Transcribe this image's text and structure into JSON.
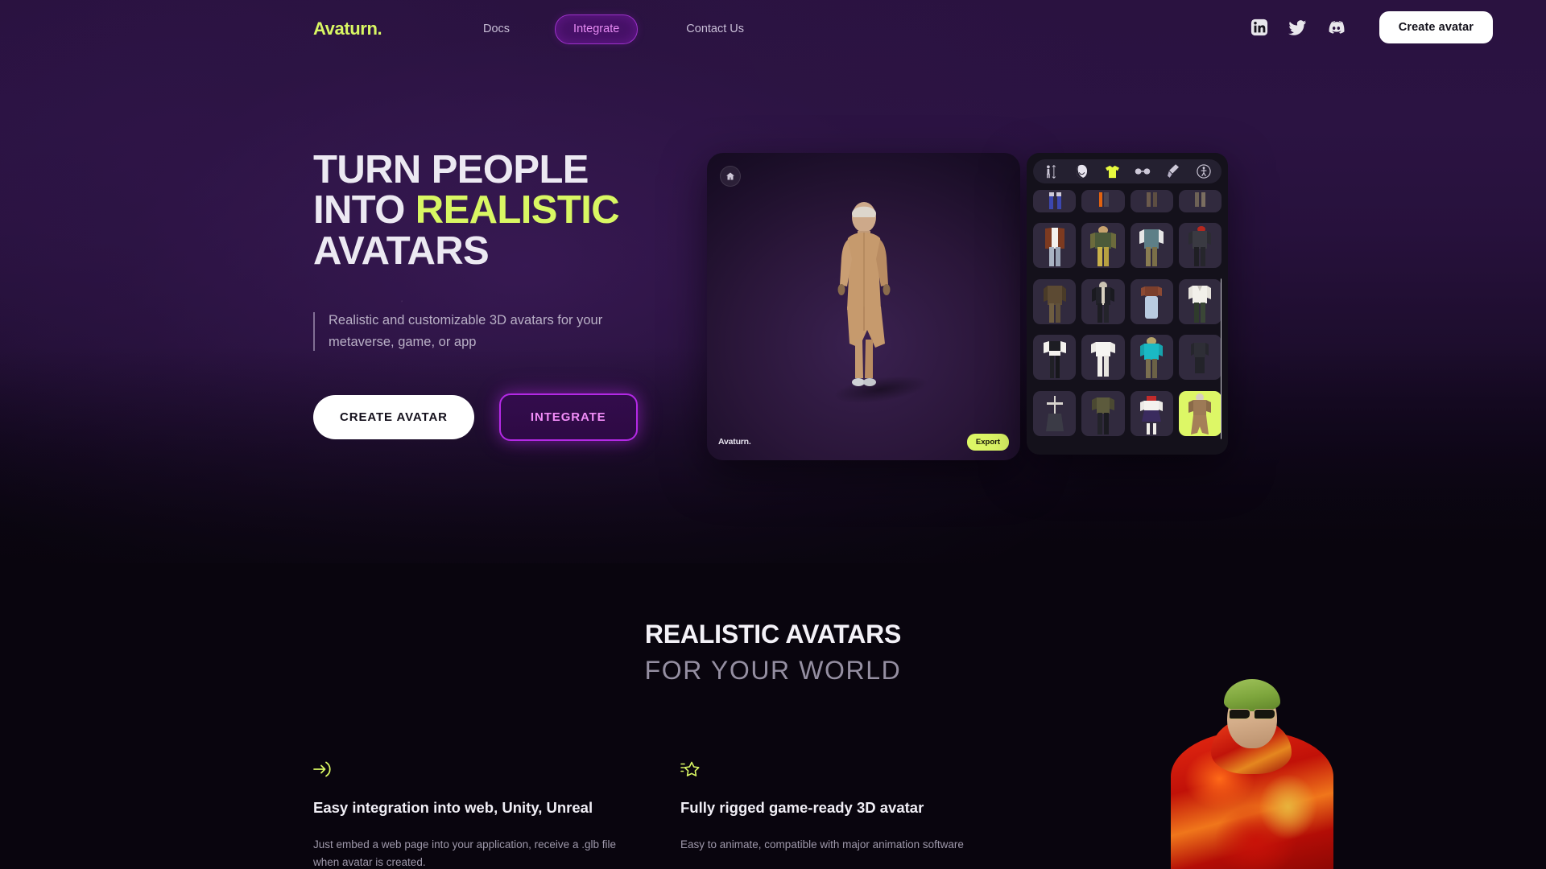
{
  "brand": {
    "name": "Avaturn.",
    "accent_color": "#d9f763",
    "purple": "#b429e6"
  },
  "header": {
    "logo": "Avaturn.",
    "nav": [
      {
        "label": "Docs",
        "active": false
      },
      {
        "label": "Integrate",
        "active": true
      },
      {
        "label": "Contact Us",
        "active": false
      }
    ],
    "socials": [
      {
        "name": "linkedin-icon"
      },
      {
        "name": "twitter-icon"
      },
      {
        "name": "discord-icon"
      }
    ],
    "cta": "Create avatar"
  },
  "hero": {
    "headline_line1": "TURN PEOPLE",
    "headline_line2_pre": "INTO ",
    "headline_line2_accent": "REALISTIC",
    "headline_line3": "AVATARS",
    "subtitle": "Realistic and customizable 3D avatars for your metaverse, game, or app",
    "primary_cta": "CREATE AVATAR",
    "secondary_cta": "INTEGRATE"
  },
  "editor": {
    "home_icon": "home-icon",
    "watermark": "Avaturn.",
    "export_label": "Export",
    "tabs": [
      {
        "name": "body-height-icon",
        "selected": false
      },
      {
        "name": "face-head-icon",
        "selected": false
      },
      {
        "name": "clothing-tshirt-icon",
        "selected": true
      },
      {
        "name": "glasses-icon",
        "selected": false
      },
      {
        "name": "makeup-brush-icon",
        "selected": false
      },
      {
        "name": "animation-pose-icon",
        "selected": false
      }
    ],
    "selected_outfit_index": 19,
    "outfit_count": 20,
    "scrollbar_visible": true
  },
  "section2": {
    "title_bold": "REALISTIC AVATARS",
    "title_light": "FOR YOUR WORLD",
    "features": [
      {
        "icon": "arrow-into-bracket-icon",
        "title": "Easy integration into web, Unity, Unreal",
        "desc": "Just embed a web page into your application, receive a .glb file when avatar is created."
      },
      {
        "icon": "shooting-star-icon",
        "title": "Fully rigged game-ready 3D avatar",
        "desc": "Easy to animate, compatible with major animation software"
      }
    ]
  }
}
